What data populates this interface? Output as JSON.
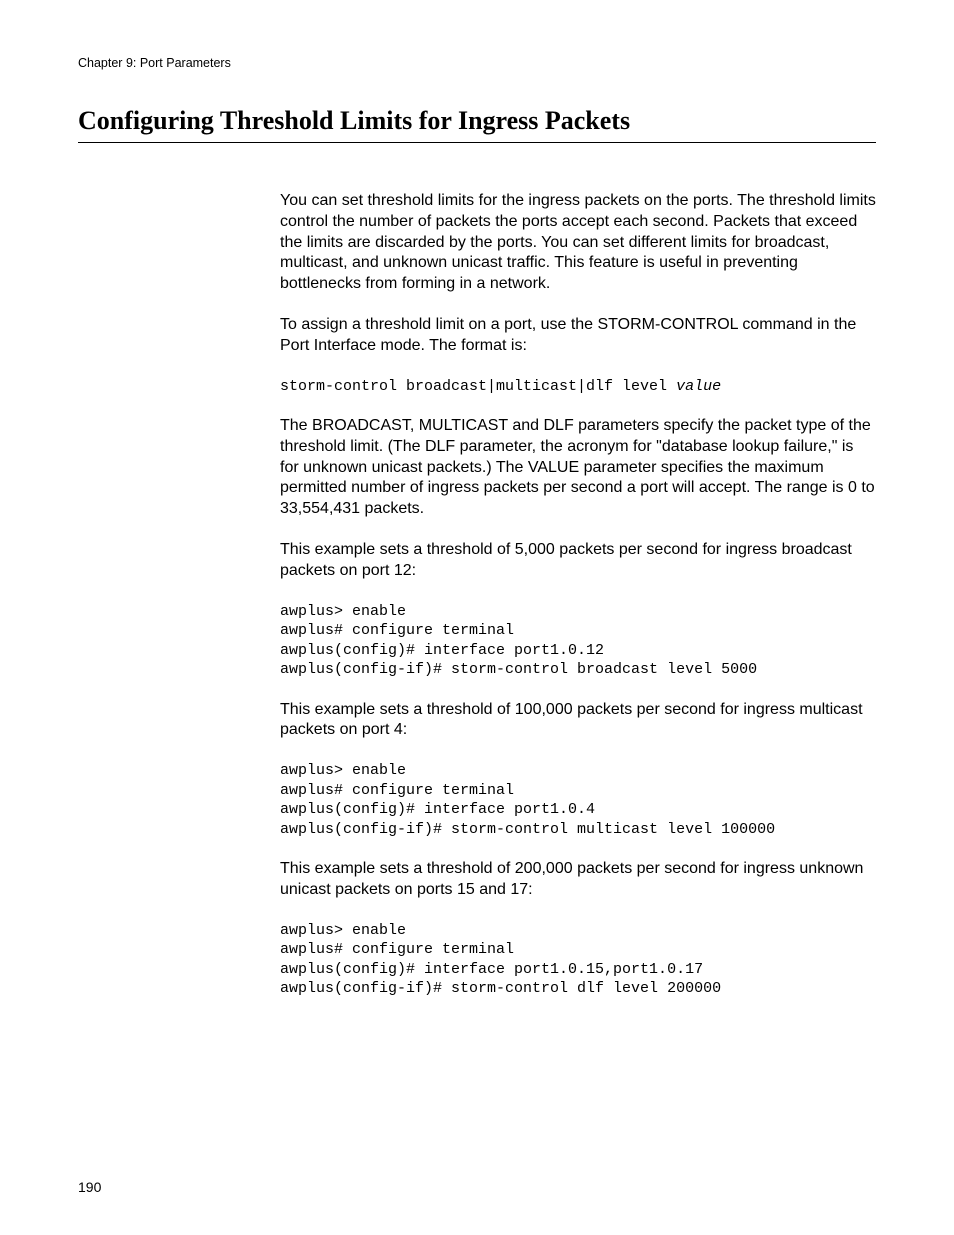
{
  "header": {
    "chapter": "Chapter 9: Port Parameters"
  },
  "section": {
    "title": "Configuring Threshold Limits for Ingress Packets"
  },
  "body": {
    "p1": "You can set threshold limits for the ingress packets on the ports. The threshold limits control the number of packets the ports accept each second. Packets that exceed the limits are discarded by the ports. You can set different limits for broadcast, multicast, and unknown unicast traffic. This feature is useful in preventing bottlenecks from forming in a network.",
    "p2": "To assign a threshold limit on a port, use the STORM-CONTROL command in the Port Interface mode. The format is:",
    "syntax_fixed": "storm-control broadcast|multicast|dlf level ",
    "syntax_italic": "value",
    "p3": "The BROADCAST, MULTICAST and DLF parameters specify the packet type of the threshold limit. (The DLF parameter, the acronym for \"database lookup failure,\" is for unknown unicast packets.) The VALUE parameter specifies the maximum permitted number of ingress packets per second a port will accept. The range is 0 to 33,554,431 packets.",
    "p4": "This example sets a threshold of 5,000 packets per second for ingress broadcast packets on port 12:",
    "ex1": "awplus> enable\nawplus# configure terminal\nawplus(config)# interface port1.0.12\nawplus(config-if)# storm-control broadcast level 5000",
    "p5": "This example sets a threshold of 100,000 packets per second for ingress multicast packets on port 4:",
    "ex2": "awplus> enable\nawplus# configure terminal\nawplus(config)# interface port1.0.4\nawplus(config-if)# storm-control multicast level 100000",
    "p6": "This example sets a threshold of 200,000 packets per second for ingress unknown unicast packets on ports 15 and 17:",
    "ex3": "awplus> enable\nawplus# configure terminal\nawplus(config)# interface port1.0.15,port1.0.17\nawplus(config-if)# storm-control dlf level 200000"
  },
  "footer": {
    "page_number": "190"
  }
}
